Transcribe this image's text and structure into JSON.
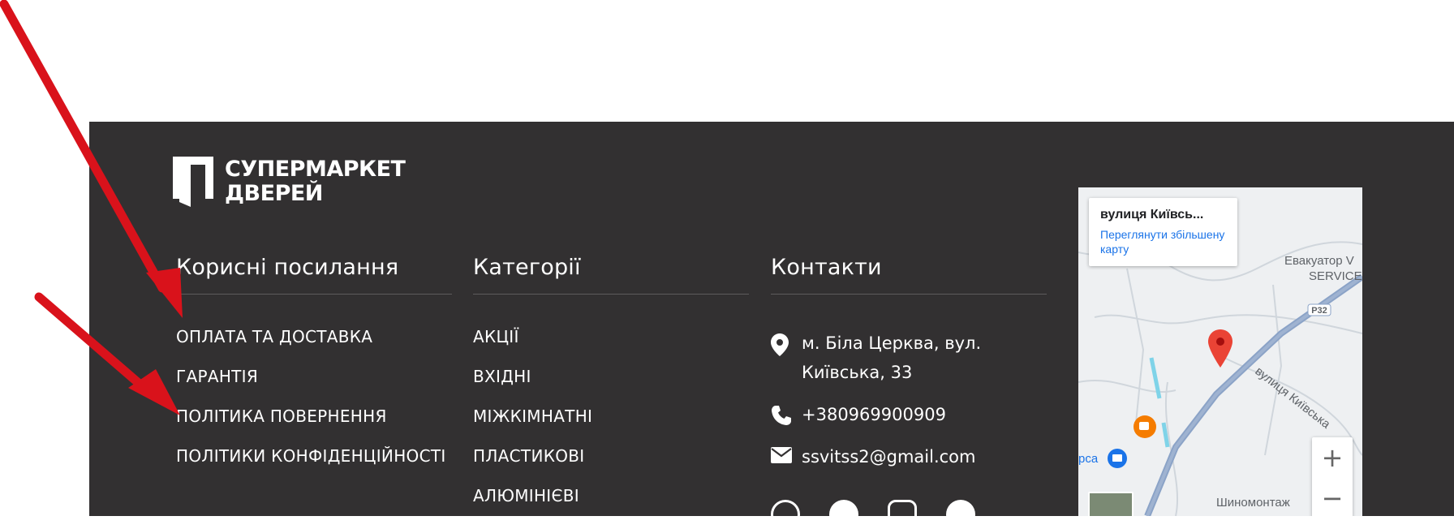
{
  "logo": {
    "line1": "СУПЕРМАРКЕТ",
    "line2": "ДВЕРЕЙ"
  },
  "useful_links": {
    "title": "Корисні посилання",
    "items": [
      "ОПЛАТА ТА ДОСТАВКА",
      "ГАРАНТІЯ",
      "ПОЛІТИКА ПОВЕРНЕННЯ",
      "ПОЛІТИКИ КОНФІДЕНЦІЙНОСТІ"
    ]
  },
  "categories": {
    "title": "Категорії",
    "items": [
      "АКЦІЇ",
      "ВХІДНІ",
      "МІЖКІМНАТНІ",
      "ПЛАСТИКОВІ",
      "АЛЮМІНІЄВІ"
    ]
  },
  "contacts": {
    "title": "Контакти",
    "address_line1": "м. Біла Церква, вул.",
    "address_line2": "Київська, 33",
    "phone": "+380969900909",
    "email": "ssvitss2@gmail.com"
  },
  "map": {
    "card_title": "вулиця Київсь...",
    "card_link_line1": "Переглянути збільшену",
    "card_link_line2": "карту",
    "label_evacuator": "Евакуатор V",
    "label_service": "SERVICE",
    "label_road": "вулиця Київська",
    "label_p32": "P32",
    "label_left": "рса",
    "label_shynomontazh": "Шиномонтаж",
    "zoom_in": "+",
    "zoom_out": "−"
  },
  "colors": {
    "footer_bg": "#323031",
    "arrow": "#d9121b",
    "map_link": "#1a73e8",
    "marker": "#ea4335"
  }
}
